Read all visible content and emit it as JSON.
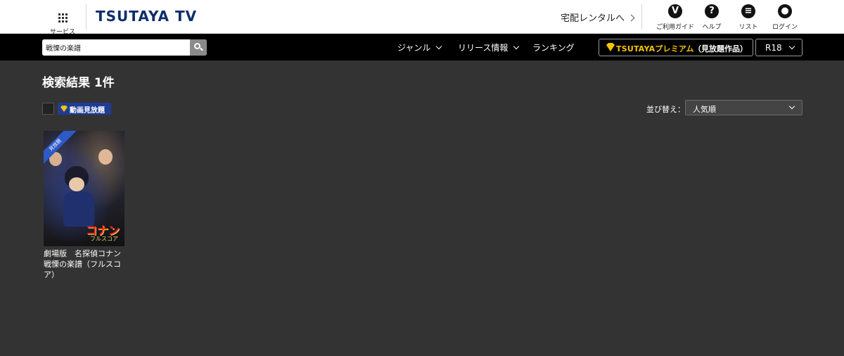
{
  "header": {
    "services_label": "サービス",
    "logo_text": "TSUTAYA TV",
    "rental_link": "宅配レンタルへ",
    "icons": [
      {
        "name": "guide",
        "glyph": "V",
        "label": "ご利用ガイド"
      },
      {
        "name": "help",
        "glyph": "?",
        "label": "ヘルプ"
      },
      {
        "name": "list",
        "glyph": "≡",
        "label": "リスト"
      },
      {
        "name": "login",
        "glyph": "●",
        "label": "ログイン"
      }
    ]
  },
  "nav": {
    "search_value": "戦慄の楽譜",
    "genre": "ジャンル",
    "release": "リリース情報",
    "ranking": "ランキング",
    "premium_brand": "TSUTAYAプレミアム",
    "premium_sub": "（見放題作品）",
    "rating_value": "R18"
  },
  "main": {
    "result_title": "検索結果 1件",
    "filter_label": "動画見放題",
    "sort_label": "並び替え：",
    "sort_value": "人気順",
    "results": [
      {
        "title": "劇場版　名探偵コナン　戦慄の楽譜（フルスコア）",
        "ribbon": "見放題",
        "thumb_logo": "コナン",
        "thumb_sub": "フルスコア"
      }
    ]
  },
  "colors": {
    "background": "#333333",
    "nav_black": "#000000",
    "logo_navy": "#0e2e6b",
    "premium_gold": "#f5c400",
    "badge_blue": "#1e3c96"
  }
}
